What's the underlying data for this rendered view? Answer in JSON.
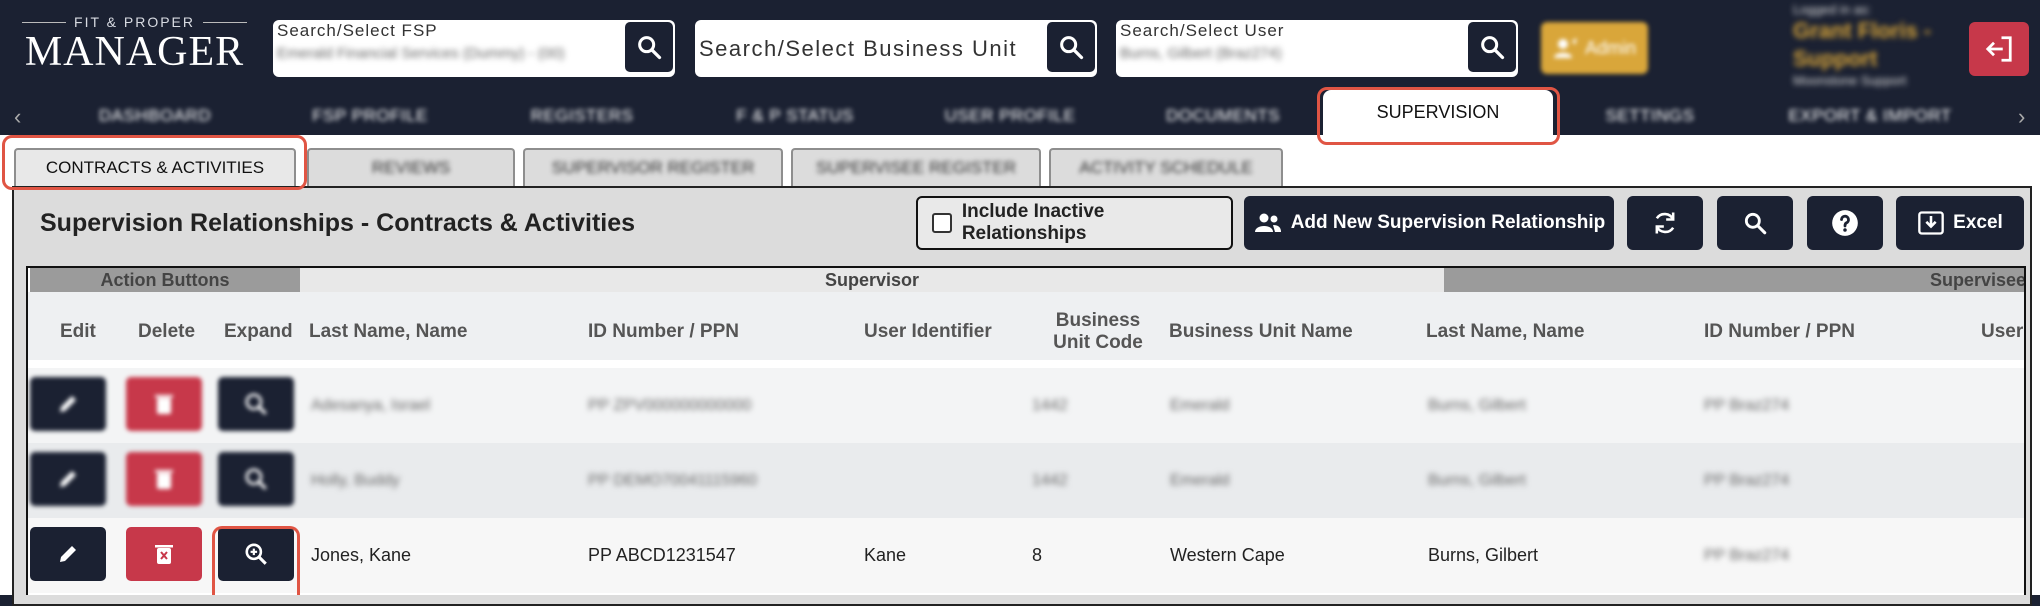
{
  "header": {
    "logo_top": "FIT & PROPER",
    "logo_main": "MANAGER",
    "fsp_search": {
      "label": "Search/Select FSP",
      "value": "Emerald Financial Services (Dummy) - (00)"
    },
    "bu_search": {
      "placeholder": "Search/Select Business Unit"
    },
    "user_search": {
      "label": "Search/Select User",
      "value": "Burns, Gilbert (Braz274)"
    },
    "admin_label": "Admin",
    "login": {
      "caption": "Logged in as:",
      "name_line1": "Grant Floris -",
      "name_line2": "Support",
      "role": "Moonstone Support"
    }
  },
  "nav": {
    "items": [
      "DASHBOARD",
      "FSP PROFILE",
      "REGISTERS",
      "F & P STATUS",
      "USER PROFILE",
      "DOCUMENTS",
      "SUPERVISION",
      "SETTINGS",
      "EXPORT & IMPORT"
    ],
    "active": "SUPERVISION",
    "left_arrow": "‹",
    "right_arrow": "›"
  },
  "subtabs": [
    "CONTRACTS & ACTIVITIES",
    "REVIEWS",
    "SUPERVISOR REGISTER",
    "SUPERVISEE REGISTER",
    "ACTIVITY SCHEDULE"
  ],
  "panel": {
    "title": "Supervision Relationships - Contracts & Activities",
    "include_inactive": "Include Inactive Relationships",
    "add_button": "Add New Supervision Relationship",
    "excel_button": "Excel"
  },
  "table": {
    "groups": {
      "actions": "Action Buttons",
      "supervisor": "Supervisor",
      "supervisee": "Supervisee"
    },
    "columns": {
      "edit": "Edit",
      "delete": "Delete",
      "expand": "Expand",
      "sup_name": "Last Name, Name",
      "sup_id": "ID Number / PPN",
      "sup_uid": "User Identifier",
      "bu_code_1": "Business",
      "bu_code_2": "Unit Code",
      "bu_name": "Business Unit Name",
      "see_name": "Last Name, Name",
      "see_id": "ID Number / PPN",
      "see_uid": "User"
    },
    "rows": [
      {
        "sup_name": "Adesanya, Israel",
        "sup_id": "PP ZPV000000000000",
        "sup_uid": "",
        "bu_code": "1442",
        "bu_name": "Emerald",
        "see_name": "Burns, Gilbert",
        "see_id": "PP Braz274"
      },
      {
        "sup_name": "Holly, Buddy",
        "sup_id": "PP DEMO70041115960",
        "sup_uid": "",
        "bu_code": "1442",
        "bu_name": "Emerald",
        "see_name": "Burns, Gilbert",
        "see_id": "PP Braz274"
      },
      {
        "sup_name": "Jones, Kane",
        "sup_id": "PP ABCD1231547",
        "sup_uid": "Kane",
        "bu_code": "8",
        "bu_name": "Western Cape",
        "see_name": "Burns, Gilbert",
        "see_id": "PP Braz274"
      }
    ]
  }
}
